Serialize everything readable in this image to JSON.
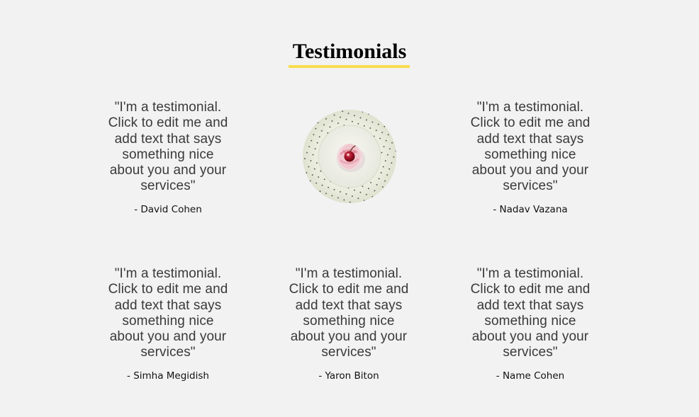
{
  "section": {
    "title": "Testimonials",
    "accent_color": "#f9dd4f"
  },
  "image": {
    "icon": "cupcake-on-plate-image"
  },
  "testimonials": [
    {
      "quote": "\"I'm a testimonial. Click to edit me and add text that says something nice about you and your services\"",
      "author": "- David Cohen"
    },
    {
      "quote": "\"I'm a testimonial. Click to edit me and add text that says something nice about you and your services\"",
      "author": "- Nadav Vazana"
    },
    {
      "quote": "\"I'm a testimonial. Click to edit me and add text that says something nice about you and your services\"",
      "author": "- Simha Megidish"
    },
    {
      "quote": "\"I'm a testimonial. Click to edit me and add text that says something nice about you and your services\"",
      "author": "- Yaron Biton"
    },
    {
      "quote": "\"I'm a testimonial. Click to edit me and add text that says something nice about you and your services\"",
      "author": "- Name Cohen"
    }
  ]
}
